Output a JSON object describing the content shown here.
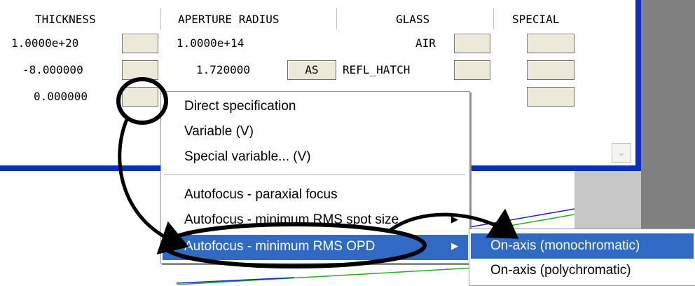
{
  "columns": [
    "THICKNESS",
    "APERTURE RADIUS",
    "GLASS",
    "SPECIAL"
  ],
  "rows": [
    {
      "thickness": "1.0000e+20",
      "aperture": "1.0000e+14",
      "aperture_button": "",
      "glass": "AIR"
    },
    {
      "thickness": "-8.000000",
      "aperture": "1.720000",
      "aperture_button": "AS",
      "glass": "REFL_HATCH"
    },
    {
      "thickness": "0.000000",
      "aperture": "",
      "aperture_button": "",
      "glass": ""
    }
  ],
  "context_menu": {
    "items": [
      "Direct specification",
      "Variable (V)",
      "Special variable... (V)",
      "Autofocus - paraxial focus",
      "Autofocus - minimum RMS spot size",
      "Autofocus - minimum RMS OPD"
    ],
    "highlighted_index": 5,
    "submenu_arrow": "▶"
  },
  "submenu": {
    "items": [
      "On-axis (monochromatic)",
      "On-axis (polychromatic)"
    ],
    "highlighted_index": 0
  },
  "scrollbar": {
    "down_glyph": "⌄"
  },
  "colors": {
    "window_border": "#0a2fc0",
    "highlight": "#316ac5",
    "button_face": "#ece9d8",
    "annotation": "#000000"
  }
}
